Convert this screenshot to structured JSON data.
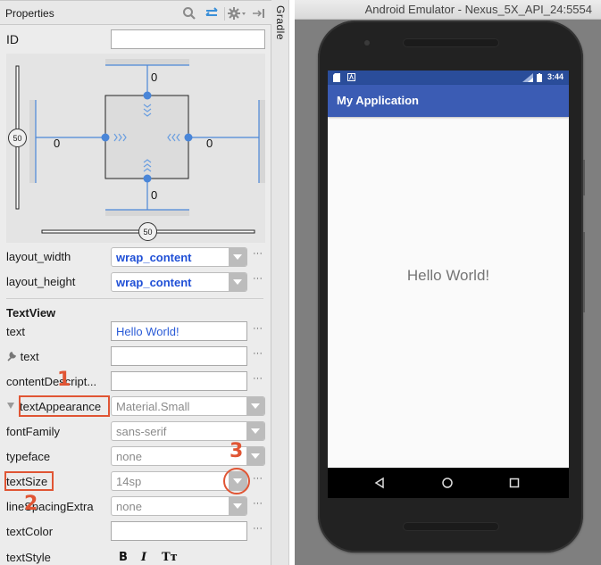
{
  "properties_panel": {
    "title": "Properties",
    "icons": [
      "search-icon",
      "swap-view-icon",
      "gear-icon",
      "hide-panel-icon"
    ],
    "id_label": "ID",
    "id_value": "",
    "constraint_widget": {
      "top_margin": "0",
      "bottom_margin": "0",
      "left_margin": "0",
      "right_margin": "0",
      "vertical_bias": "50",
      "horizontal_bias": "50"
    },
    "layout_width": {
      "label": "layout_width",
      "value": "wrap_content"
    },
    "layout_height": {
      "label": "layout_height",
      "value": "wrap_content"
    },
    "section_title": "TextView",
    "rows": {
      "text": {
        "label": "text",
        "value": "Hello World!"
      },
      "tools_text": {
        "label": "text",
        "value": ""
      },
      "content_description": {
        "label": "contentDescript...",
        "value": ""
      },
      "text_appearance": {
        "label": "textAppearance",
        "value": "Material.Small"
      },
      "font_family": {
        "label": "fontFamily",
        "value": "sans-serif"
      },
      "typeface": {
        "label": "typeface",
        "value": "none"
      },
      "text_size": {
        "label": "textSize",
        "value": "14sp"
      },
      "line_spacing_extra": {
        "label": "lineSpacingExtra",
        "value": "none"
      },
      "text_color": {
        "label": "textColor",
        "value": ""
      },
      "text_style": {
        "label": "textStyle",
        "bold": "B",
        "italic": "I",
        "caps": "Tт"
      }
    },
    "ellipsis": "···",
    "annotations": [
      "1",
      "2",
      "3"
    ]
  },
  "side_tool_window": {
    "label": "Gradle"
  },
  "emulator": {
    "window_title": "Android Emulator - Nexus_5X_API_24:5554",
    "status_time": "3:44",
    "app_title": "My Application",
    "content_text": "Hello World!",
    "nav_buttons": [
      "back",
      "home",
      "recents"
    ]
  },
  "colors": {
    "accent_blue": "#3b5cb4",
    "status_blue": "#2a4d9a",
    "annotation_red": "#e05534",
    "constraint_blue": "#4a86d8",
    "value_blue": "#1f4fd6"
  }
}
